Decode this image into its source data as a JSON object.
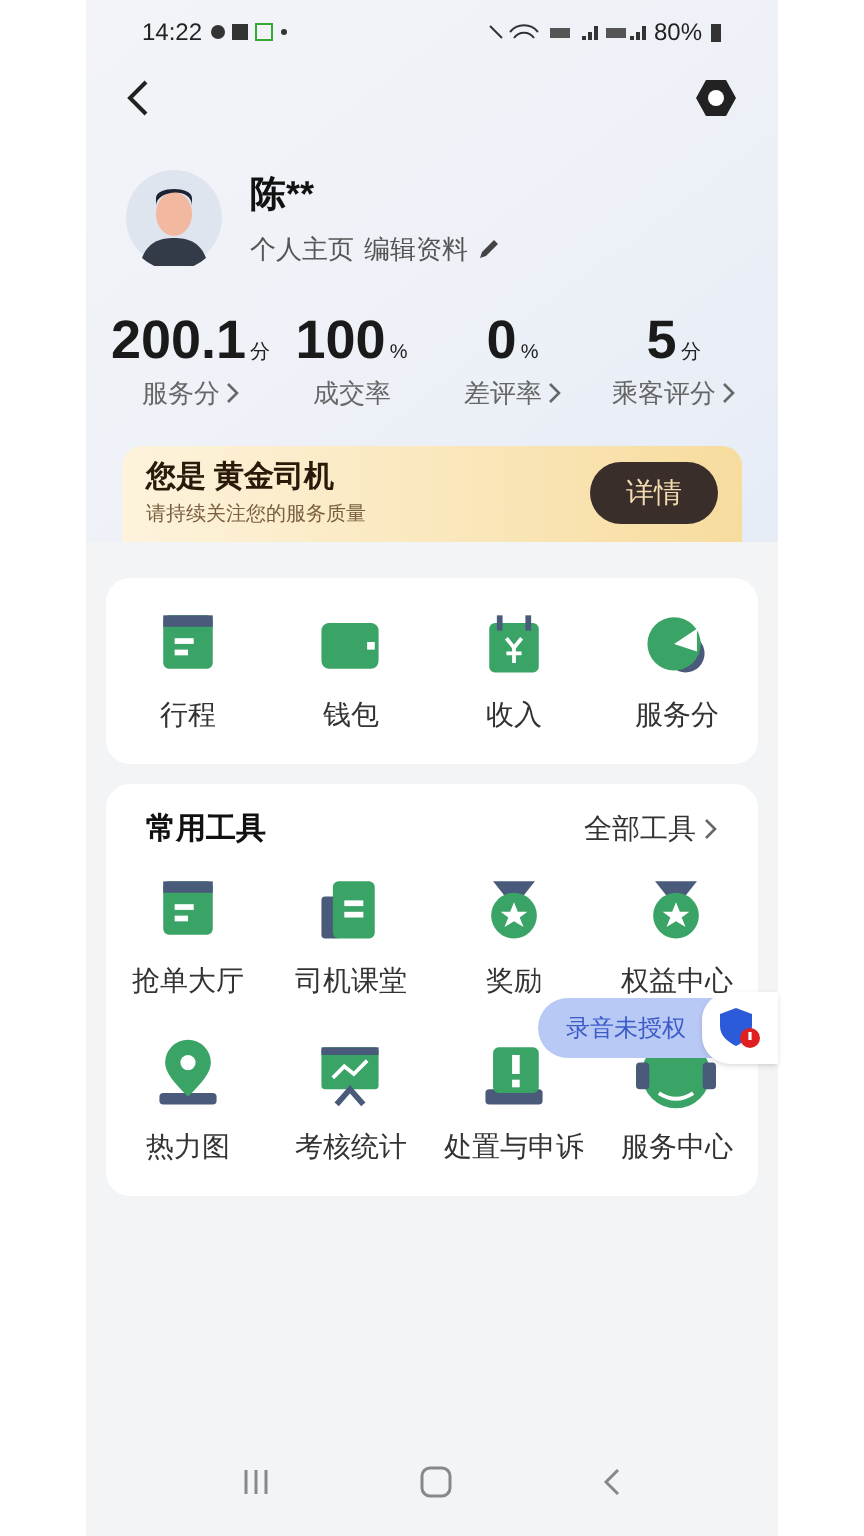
{
  "status_bar": {
    "time": "14:22",
    "battery": "80%"
  },
  "profile": {
    "name": "陈**",
    "home_link": "个人主页",
    "edit_link": "编辑资料"
  },
  "stats": [
    {
      "value": "200.1",
      "unit": "分",
      "label": "服务分",
      "arrow": true
    },
    {
      "value": "100",
      "unit": "%",
      "label": "成交率",
      "arrow": false
    },
    {
      "value": "0",
      "unit": "%",
      "label": "差评率",
      "arrow": true
    },
    {
      "value": "5",
      "unit": "分",
      "label": "乘客评分",
      "arrow": true
    }
  ],
  "banner": {
    "title": "您是 黄金司机",
    "subtitle": "请持续关注您的服务质量",
    "button": "详情"
  },
  "main_shortcuts": [
    {
      "label": "行程",
      "kind": "card"
    },
    {
      "label": "钱包",
      "kind": "wallet"
    },
    {
      "label": "收入",
      "kind": "calendar"
    },
    {
      "label": "服务分",
      "kind": "pie"
    }
  ],
  "tools": {
    "title": "常用工具",
    "all_link": "全部工具",
    "items": [
      {
        "label": "抢单大厅",
        "kind": "card"
      },
      {
        "label": "司机课堂",
        "kind": "book"
      },
      {
        "label": "奖励",
        "kind": "medal"
      },
      {
        "label": "权益中心",
        "kind": "medal"
      },
      {
        "label": "热力图",
        "kind": "pin"
      },
      {
        "label": "考核统计",
        "kind": "chart"
      },
      {
        "label": "处置与申诉",
        "kind": "alert"
      },
      {
        "label": "服务中心",
        "kind": "headset"
      }
    ]
  },
  "recording_tip": {
    "text": "录音未授权"
  }
}
